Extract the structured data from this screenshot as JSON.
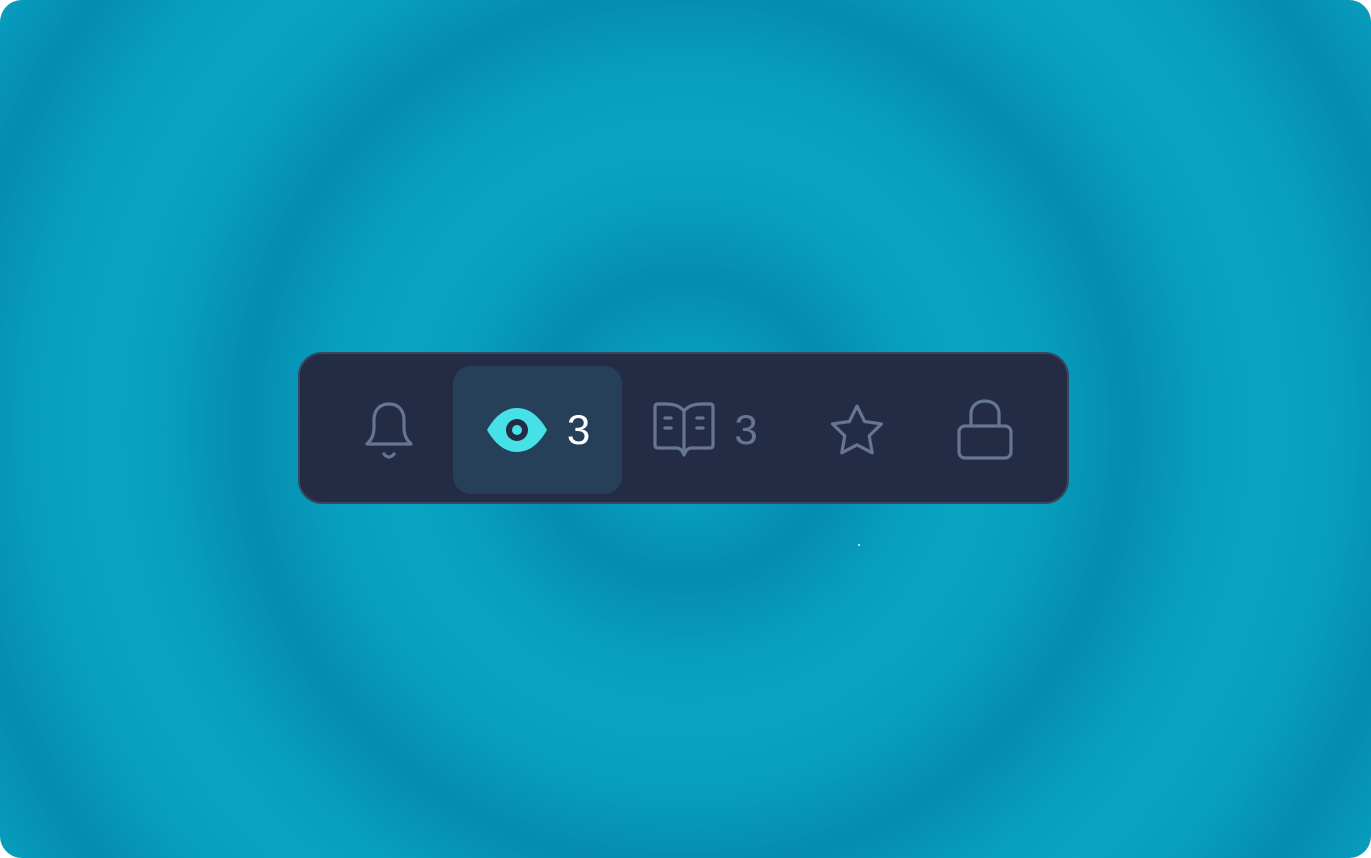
{
  "colors": {
    "toolbar_bg": "#242c45",
    "active_bg": "#27405a",
    "accent": "#46e1e6",
    "muted_icon": "#66768f",
    "active_count": "#ffffff"
  },
  "toolbar": {
    "items": [
      {
        "icon": "bell-icon",
        "count": "",
        "active": false
      },
      {
        "icon": "eye-icon",
        "count": "3",
        "active": true
      },
      {
        "icon": "open-book-icon",
        "count": "3",
        "active": false
      },
      {
        "icon": "star-icon",
        "count": "",
        "active": false
      },
      {
        "icon": "lock-icon",
        "count": "",
        "active": false
      }
    ]
  }
}
